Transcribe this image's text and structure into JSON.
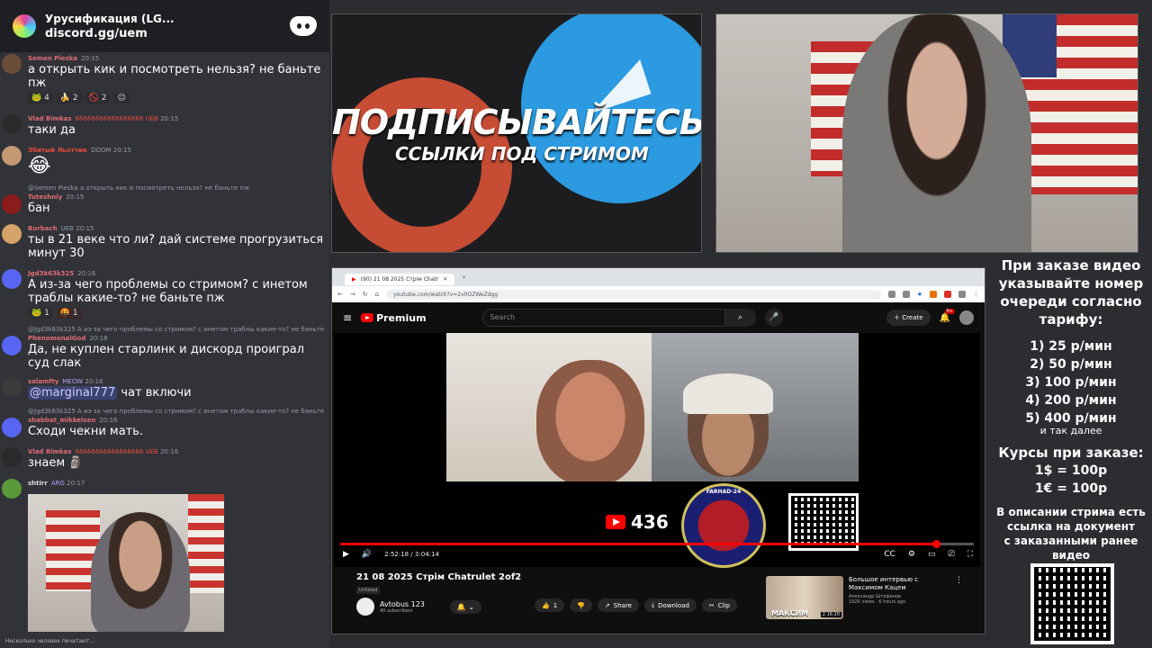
{
  "discord": {
    "server_name": "Урусификация (LG...",
    "invite": "discord.gg/uem",
    "typing": "Несколько человек печатают..."
  },
  "messages": [
    {
      "user": "Semen Pieska",
      "time": "20:15",
      "text": "а открыть кик и посмотреть нельзя? не баньте пж",
      "name_color": "#e06c75"
    },
    {
      "reactions": [
        "4",
        "2",
        "2"
      ]
    },
    {
      "user": "Vlad Bimkas",
      "badges": "66666666666666666 UEB",
      "time": "20:15",
      "text": "таки да",
      "name_color": "#e06c75"
    },
    {
      "user": "Збитый Льотчик",
      "badges": "DOOM",
      "time": "20:15",
      "text": "😂",
      "name_color": "#e74c3c"
    },
    {
      "reply": "@Semen Pieska а открыть кик и посмотреть нельзя? не баньте пж",
      "user": "Tuteshniy",
      "time": "20:15",
      "text": "бан",
      "name_color": "#e06c75"
    },
    {
      "user": "Burbach",
      "badges": "UEB",
      "time": "20:15",
      "text": "ты в 21 веке что ли? дай системе прогрузиться минут 30",
      "name_color": "#e06c75"
    },
    {
      "user": "Jgd3k63k325",
      "time": "20:16",
      "text": "А из-за чего проблемы со стримом? с инетом траблы какие-то? не баньте пж",
      "name_color": "#e06c75",
      "reactions": [
        "1",
        "1"
      ]
    },
    {
      "reply": "@Jgd3k63k325 А из-за чего проблемы со стримом? с инетом траблы какие-то? не баньте пж",
      "user": "PhenomenalGod",
      "time": "20:16",
      "text": "Да, не куплен старлинк и дискорд проиграл суд слак",
      "name_color": "#e06c75"
    },
    {
      "user": "salamfty",
      "badges": "MEOW",
      "time": "20:16",
      "mention": "@marginal777",
      "text": " чат включи",
      "name_color": "#e06c75"
    },
    {
      "reply": "@Jgd3k63k325 А из-за чего проблемы со стримом? с инетом траблы какие-то? не баньте пж",
      "user": "shabbat_mikkelsen",
      "time": "20:16",
      "text": "Сходи чекни мать.",
      "name_color": "#e06c75"
    },
    {
      "user": "Vlad Bimkas",
      "badges": "66666666666666666 UEB",
      "time": "20:16",
      "text": "знаем",
      "name_color": "#e06c75"
    },
    {
      "user": "shtirr",
      "badges": "ARG",
      "time": "20:17",
      "text": "",
      "name_color": "#dbdee1"
    }
  ],
  "promo": {
    "title": "ПОДПИСЫВАЙТЕСЬ",
    "subtitle": "ССЫЛКИ ПОД СТРИМОМ"
  },
  "browser": {
    "tab_title": "(90) 21 08 2025 Стрім Chatr",
    "url": "youtube.com/watch?v=2v0OZWeZdgg"
  },
  "youtube": {
    "logo": "Premium",
    "search_placeholder": "Search",
    "create": "Create",
    "notif_count": "9+",
    "overlay_count": "436",
    "badge_text": "FARHAD-24",
    "time": "2:52:18 / 3:04:14",
    "progress": 0.94,
    "video_title": "21 08 2025 Стрім Chatrulet 2of2",
    "unlisted": "Unlisted",
    "channel": "Avtobus 123",
    "subscribers": "40 subscribers",
    "likes": "1",
    "share": "Share",
    "download": "Download",
    "clip": "Clip",
    "rec_title": "Большое интервью с Максимом Кацем",
    "rec_channel": "Александр Штефанов",
    "rec_meta": "192K views · 6 hours ago",
    "rec_thumb_label": "МАКСИМ",
    "rec_duration": "2:16:20"
  },
  "info": {
    "order_text": [
      "При заказе видео",
      "указывайте номер",
      "очереди согласно",
      "тарифу:"
    ],
    "tariffs": [
      "1) 25 р/мин",
      "2) 50 р/мин",
      "3) 100 р/мин",
      "4) 200 р/мин",
      "5) 400 р/мин"
    ],
    "etc": "и так далее",
    "rates_title": "Курсы при заказе:",
    "rates": [
      "1$ = 100р",
      "1€ = 100р"
    ],
    "description": [
      "В описании стрима есть",
      "ссылка на документ",
      "с заказанными ранее",
      "видео"
    ]
  }
}
